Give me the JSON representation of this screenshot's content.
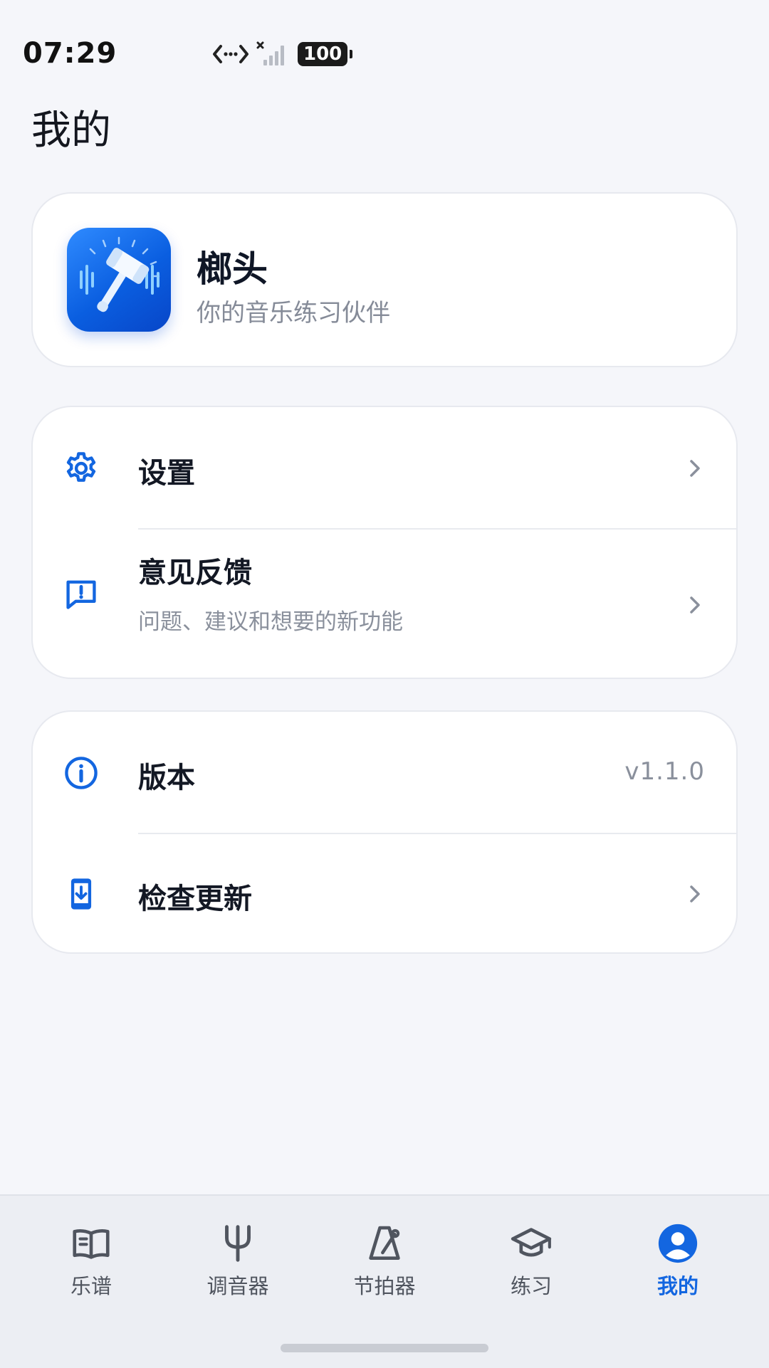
{
  "status_bar": {
    "time": "07:29",
    "battery": "100"
  },
  "page": {
    "title": "我的"
  },
  "profile": {
    "app_name": "榔头",
    "tagline": "你的音乐练习伙伴"
  },
  "menu": {
    "settings": {
      "label": "设置",
      "icon": "gear-icon"
    },
    "feedback": {
      "label": "意见反馈",
      "subtitle": "问题、建议和想要的新功能",
      "icon": "feedback-icon"
    },
    "version": {
      "label": "版本",
      "value": "v1.1.0",
      "icon": "info-icon"
    },
    "check_update": {
      "label": "检查更新",
      "icon": "download-icon"
    }
  },
  "tabs": [
    {
      "label": "乐谱",
      "icon": "book-icon"
    },
    {
      "label": "调音器",
      "icon": "tuning-fork-icon"
    },
    {
      "label": "节拍器",
      "icon": "metronome-icon"
    },
    {
      "label": "练习",
      "icon": "graduation-cap-icon"
    },
    {
      "label": "我的",
      "icon": "user-icon",
      "active": true
    }
  ],
  "colors": {
    "accent": "#1366e0",
    "background": "#f5f6fa",
    "card": "#ffffff",
    "muted_text": "#8a909c"
  }
}
